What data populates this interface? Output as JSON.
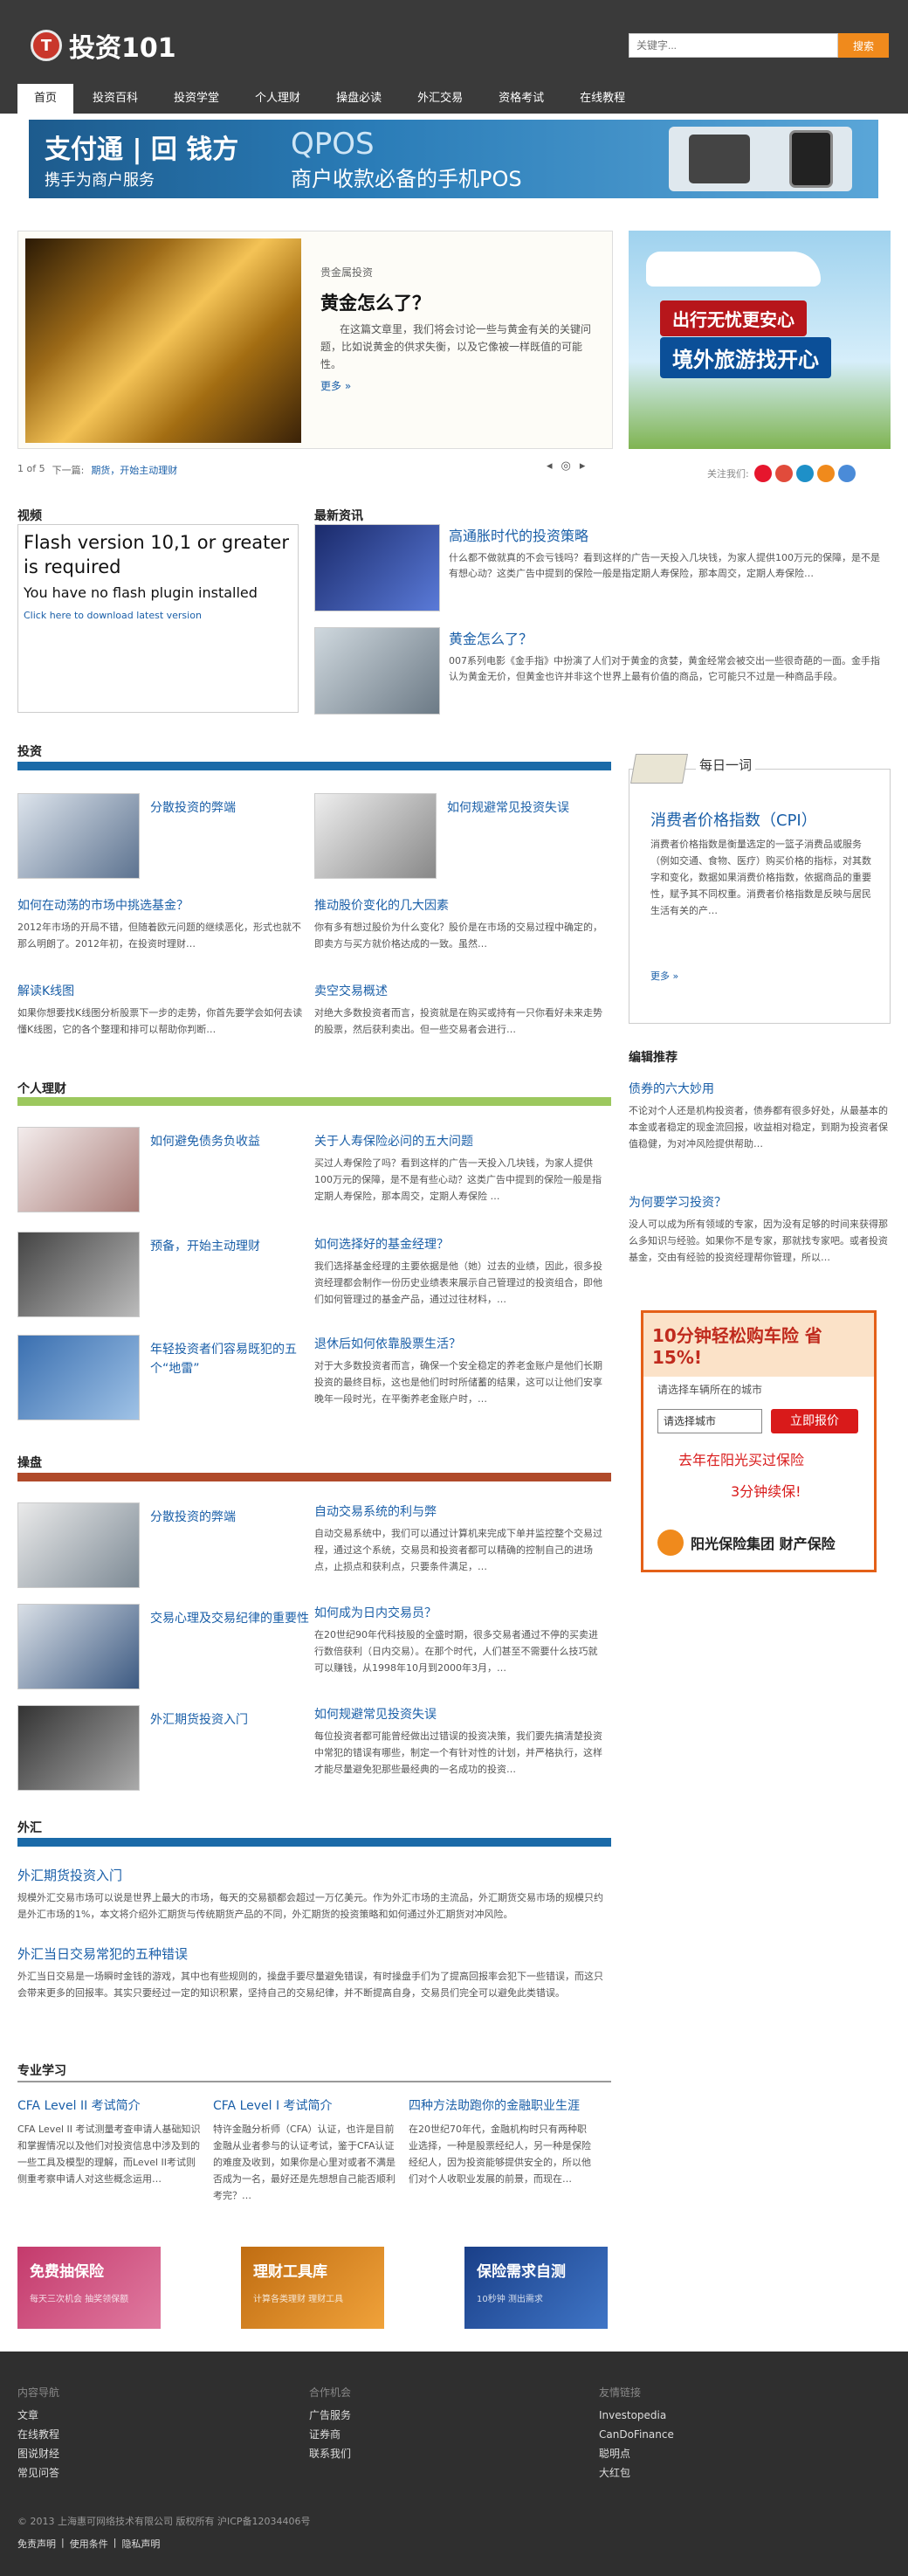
{
  "logo": {
    "icon": "T",
    "text": "投资101"
  },
  "search": {
    "placeholder": "关键字...",
    "button": "搜索"
  },
  "nav": [
    "首页",
    "投资百科",
    "投资学堂",
    "个人理财",
    "操盘必读",
    "外汇交易",
    "资格考试",
    "在线教程"
  ],
  "banner": {
    "brand": "支付通 | 回 钱方",
    "slogan": "携手为商户服务",
    "product": "QPOS",
    "tagline": "商户收款必备的手机POS"
  },
  "featured": {
    "category": "贵金属投资",
    "title": "黄金怎么了？",
    "desc": "在这篇文章里，我们将会讨论一些与黄金有关的关键问题，比如说黄金的供求失衡，以及它像被一样既值的可能性。",
    "more": "更多 »",
    "pager": {
      "count": "1 of 5",
      "next_label": "下一篇:",
      "next": "期货，开始主动理财"
    }
  },
  "ad_right": {
    "line1": "出行无忧更安心",
    "line2": "境外旅游找开心"
  },
  "follow": {
    "label": "关注我们:"
  },
  "video": {
    "title": "视频",
    "line1": "Flash version 10,1 or greater is required",
    "line2": "You have no flash plugin installed",
    "link": "Click here to download latest version"
  },
  "latest": {
    "title": "最新资讯",
    "items": [
      {
        "h": "高通胀时代的投资策略",
        "d": "什么都不做就真的不会亏钱吗？看到这样的广告一天投入几块钱，为家人提供100万元的保障，是不是有想心动？这类广告中提到的保险一般是指定期人寿保险，那本周交，定期人寿保险…"
      },
      {
        "h": "黄金怎么了？",
        "d": "007系列电影《金手指》中扮演了人们对于黄金的贪婪，黄金经常会被交出一些很奇葩的一面。金手指认为黄金无价，但黄金也许并非这个世界上最有价值的商品，它可能只不过是一种商品手段。"
      }
    ]
  },
  "invest": {
    "title": "投资",
    "items": [
      {
        "h": "分散投资的弊端"
      },
      {
        "h": "如何规避常见投资失误"
      }
    ],
    "arts": [
      {
        "h": "如何在动荡的市场中挑选基金？",
        "d": "2012年市场的开局不错，但随着欧元问题的继续恶化，形式也就不那么明朗了。2012年初，在投资时理财…"
      },
      {
        "h": "推动股价变化的几大因素",
        "d": "你有多有想过股价为什么变化？股价是在市场的交易过程中确定的，即卖方与买方就价格达成的一致。虽然…"
      },
      {
        "h": "解读K线图",
        "d": "如果你想要找K线图分析股票下一步的走势，你首先要学会如何去读懂K线图，它的各个整理和排可以帮助你判断…"
      },
      {
        "h": "卖空交易概述",
        "d": "对绝大多数投资者而言，投资就是在购买或持有一只你看好未来走势的股票，然后获利卖出。但一些交易者会进行…"
      }
    ]
  },
  "daily": {
    "title": "每日一词",
    "h": "消费者价格指数（CPI）",
    "d": "消费者价格指数是衡量选定的一篮子消费品或服务（例如交通、食物、医疗）购买价格的指标，对其数字和变化，数据如果消费价格指数，依据商品的重要性，赋予其不同权重。消费者价格指数是反映与居民生活有关的产…",
    "more": "更多 »"
  },
  "personal": {
    "title": "个人理财",
    "items": [
      {
        "h": "如何避免债务负收益",
        "ah": "关于人寿保险必问的五大问题",
        "ad": "买过人寿保险了吗？看到这样的广告一天投入几块钱，为家人提供100万元的保障，是不是有些心动？这类广告中提到的保险一般是指定期人寿保险，那本周交，定期人寿保险 …"
      },
      {
        "h": "预备，开始主动理财",
        "ah": "如何选择好的基金经理？",
        "ad": "我们选择基金经理的主要依据是他（她）过去的业绩，因此，很多投资经理都会制作一份历史业绩表来展示自己管理过的投资组合，即他们如何管理过的基金产品，通过过往材料，…"
      },
      {
        "h": "年轻投资者们容易既犯的五个“地雷”",
        "ah": "退休后如何依靠股票生活？",
        "ad": "对于大多数投资者而言，确保一个安全稳定的养老金账户是他们长期投资的最终目标，这也是他们时时所储蓄的结果，这可以让他们安享晚年一段时光，在平衡养老金账户时，…"
      }
    ]
  },
  "editor": {
    "title": "编辑推荐",
    "items": [
      {
        "h": "债券的六大妙用",
        "d": "不论对个人还是机构投资者，债券都有很多好处，从最基本的本金或者稳定的现金流回报，收益相对稳定，到期为投资者保值稳健，为对冲风险提供帮助…"
      },
      {
        "h": "为何要学习投资？",
        "d": "没人可以成为所有领域的专家，因为没有足够的时间来获得那么多知识与经验。如果你不是专家，那就找专家吧。或者投资基金，交由有经验的投资经理帮你管理，所以…"
      }
    ]
  },
  "ad2": {
    "title": "10分钟轻松购车险 省15%!",
    "prompt": "请选择车辆所在的城市",
    "select": "请选择城市",
    "button": "立即报价",
    "slogan1": "去年在阳光买过保险",
    "slogan2": "3分钟续保!",
    "brand": "阳光保险集团 财产保险"
  },
  "trading": {
    "title": "操盘",
    "items": [
      {
        "h": "分散投资的弊端",
        "ah": "自动交易系统的利与弊",
        "ad": "自动交易系统中，我们可以通过计算机来完成下单并监控整个交易过程，通过这个系统，交易员和投资者都可以精确的控制自己的进场点，止损点和获利点，只要条件满足，…"
      },
      {
        "h": "交易心理及交易纪律的重要性",
        "ah": "如何成为日内交易员？",
        "ad": "在20世纪90年代科技股的全盛时期，很多交易者通过不停的买卖进行数倍获利（日内交易）。在那个时代，人们甚至不需要什么技巧就可以赚钱，从1998年10月到2000年3月，…"
      },
      {
        "h": "外汇期货投资入门",
        "ah": "如何规避常见投资失误",
        "ad": "每位投资者都可能曾经做出过错误的投资决策，我们要先搞清楚投资中常犯的错误有哪些，制定一个有针对性的计划，并严格执行，这样才能尽量避免犯那些最经典的一名成功的投资…"
      }
    ]
  },
  "forex": {
    "title": "外汇",
    "items": [
      {
        "h": "外汇期货投资入门",
        "d": "规模外汇交易市场可以说是世界上最大的市场，每天的交易额都会超过一万亿美元。作为外汇市场的主流品，外汇期货交易市场的规模只约是外汇市场的1%，本文将介绍外汇期货与传统期货产品的不同，外汇期货的投资策略和如何通过外汇期货对冲风险。"
      },
      {
        "h": "外汇当日交易常犯的五种错误",
        "d": "外汇当日交易是一场瞬时金钱的游戏，其中也有些规则的，操盘手要尽量避免错误，有时操盘手们为了提高回报率会犯下一些错误，而这只会带来更多的回报率。其实只要经过一定的知识积累，坚持自己的交易纪律，并不断提高自身，交易员们完全可以避免此类错误。"
      }
    ]
  },
  "pro": {
    "title": "专业学习",
    "items": [
      {
        "h": "CFA Level II 考试简介",
        "d": "CFA Level II 考试测量考查申请人基础知识和掌握情况以及他们对投资信息中涉及到的一些工具及模型的理解，而Level II考试则侧重考察申请人对这些概念运用…"
      },
      {
        "h": "CFA Level I 考试简介",
        "d": "特许金融分析师（CFA）认证，也许是目前金融从业者参与的认证考试，鉴于CFA认证的难度及收到，如果你是心里对或者不满是否成为一名，最好还是先想想自己能否顺利考完？…"
      },
      {
        "h": "四种方法助跑你的金融职业生涯",
        "d": "在20世纪70年代，金融机构时只有两种职业选择，一种是股票经纪人，另一种是保险经纪人，因为投资能够提供安全的，所以他们对个人收职业发展的前景，而现在…"
      }
    ]
  },
  "tiles": [
    {
      "t": "免费抽保险",
      "s": "每天三次机会 抽奖领保额"
    },
    {
      "t": "理财工具库",
      "s": "计算各类理财 理财工具"
    },
    {
      "t": "保险需求自测",
      "s": "10秒钟 测出需求"
    }
  ],
  "footer": {
    "cols": [
      {
        "hd": "内容导航",
        "items": [
          "文章",
          "在线教程",
          "图说财经",
          "常见问答"
        ]
      },
      {
        "hd": "合作机会",
        "items": [
          "广告服务",
          "证券商",
          "联系我们"
        ]
      },
      {
        "hd": "友情链接",
        "items": [
          "Investopedia",
          "CanDoFinance",
          "聪明点",
          "大红包"
        ]
      }
    ],
    "copy": "© 2013 上海惠可网络技术有限公司 版权所有 沪ICP备12034406号",
    "links": [
      "免责声明",
      "使用条件",
      "隐私声明"
    ]
  },
  "colors": {
    "invest": "#1a6aa8",
    "personal": "#9cc85e",
    "trading": "#b04a2a",
    "forex": "#1a6aa8"
  }
}
